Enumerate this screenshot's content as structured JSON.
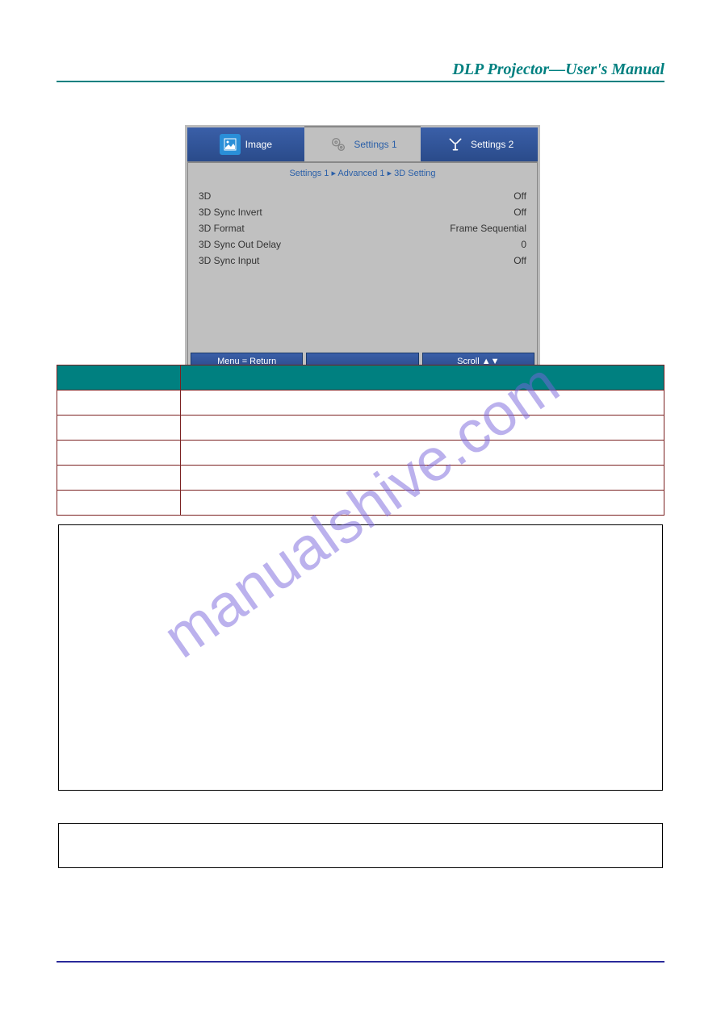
{
  "header": {
    "title": "DLP Projector—User's Manual"
  },
  "osd": {
    "tabs": {
      "image": "Image",
      "settings1": "Settings 1",
      "settings2": "Settings 2"
    },
    "breadcrumb": "Settings 1 ▸ Advanced 1 ▸ 3D Setting",
    "rows": [
      {
        "label": "3D",
        "value": "Off"
      },
      {
        "label": "3D Sync Invert",
        "value": "Off"
      },
      {
        "label": "3D Format",
        "value": "Frame Sequential"
      },
      {
        "label": "3D Sync Out Delay",
        "value": "0"
      },
      {
        "label": "3D Sync Input",
        "value": "Off"
      }
    ],
    "footer": {
      "left": "Menu = Return",
      "middle": "",
      "right": "Scroll ▲▼"
    }
  },
  "watermark": "manualshive.com"
}
